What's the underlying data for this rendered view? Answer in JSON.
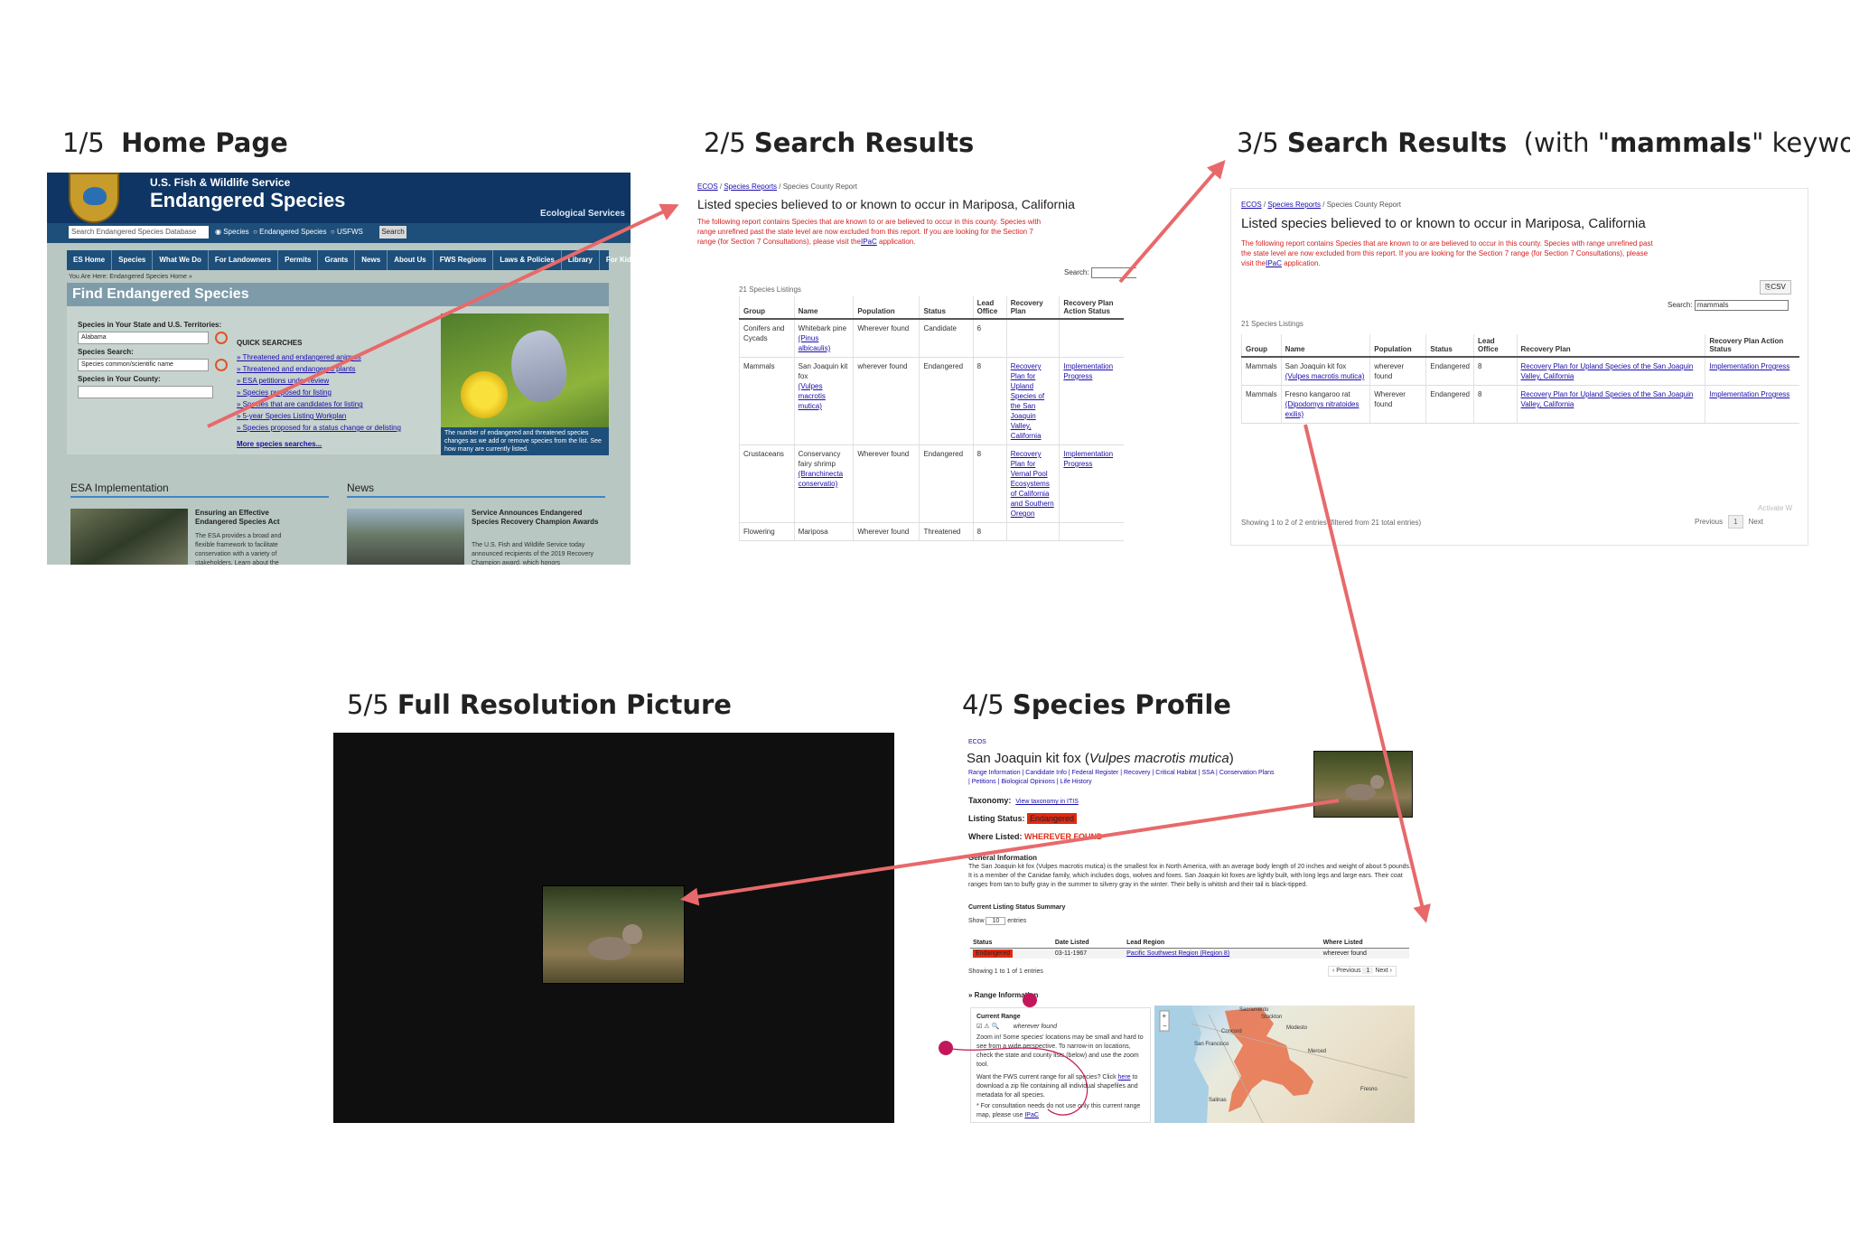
{
  "titles": {
    "t1": {
      "num": "1/5",
      "text": "Home Page"
    },
    "t2": {
      "num": "2/5",
      "text": "Search Results"
    },
    "t3": {
      "num": "3/5",
      "text": "Search Results",
      "suffix_pre": "(with \"",
      "keyword": "mammals",
      "suffix_post": "\" keyword)"
    },
    "t4": {
      "num": "4/5",
      "text": "Species Profile"
    },
    "t5": {
      "num": "5/5",
      "text": "Full Resolution Picture"
    }
  },
  "home": {
    "agency": "U.S. Fish & Wildlife Service",
    "site_title": "Endangered Species",
    "eco": "Ecological Services",
    "search_placeholder": "Search Endangered Species Database",
    "radio_species": "Species",
    "radio_endangered": "Endangered Species",
    "radio_usfws": "USFWS",
    "search_button": "Search",
    "nav": [
      "ES Home",
      "Species",
      "What We Do",
      "For Landowners",
      "Permits",
      "Grants",
      "News",
      "About Us",
      "FWS Regions",
      "Laws & Policies",
      "Library",
      "For Kids"
    ],
    "crumb": "You Are Here: Endangered Species Home »",
    "find_title": "Find Endangered Species",
    "state_label": "Species in Your State and U.S. Territories:",
    "state_value": "Alabama",
    "species_search_label": "Species Search:",
    "species_search_placeholder": "Species common/scientific name",
    "county_label": "Species in Your County:",
    "quick_searches": "QUICK SEARCHES",
    "quick_links": [
      "Threatened and endangered animals",
      "Threatened and endangered plants",
      "ESA petitions under review",
      "Species proposed for listing",
      "Species that are candidates for listing",
      "5-year Species Listing Workplan",
      "Species proposed for a status change or delisting"
    ],
    "more": "More species searches...",
    "caption": "The number of endangered and threatened species changes as we add or remove species from the list. See how many are currently listed.",
    "esa_heading": "ESA Implementation",
    "news_heading": "News",
    "article1_title": "Ensuring an Effective Endangered Species Act",
    "article1_text": "The ESA provides a broad and flexible framework to facilitate conservation with a variety of stakeholders. Learn about the",
    "article2_title": "Service Announces Endangered Species Recovery Champion Awards",
    "article2_text": "The U.S. Fish and Wildlife Service today announced recipients of the 2019 Recovery Champion award, which honors"
  },
  "report": {
    "crumb_ecos": "ECOS",
    "crumb_reports": "Species Reports",
    "crumb_current": "Species County Report",
    "title": "Listed species believed to or known to occur in Mariposa, California",
    "note_pre": "The following report contains Species that are known to or are believed to occur in this county. Species with range unrefined past the state level are now excluded from this report. If you are looking for the Section 7 range (for Section 7 Consultations), please visit the",
    "note_link": "IPaC",
    "note_post": " application.",
    "csv": "CSV",
    "search_label": "Search:",
    "search_value": "mammals",
    "count": "21 Species Listings",
    "headers": [
      "Group",
      "Name",
      "Population",
      "Status",
      "Lead Office",
      "Recovery Plan",
      "Recovery Plan Action Status"
    ],
    "rows_all": [
      {
        "group": "Conifers and Cycads",
        "name": "Whitebark pine",
        "sci": "Pinus albicaulis",
        "pop": "Wherever found",
        "status": "Candidate",
        "office": "6",
        "plan": "",
        "action": ""
      },
      {
        "group": "Mammals",
        "name": "San Joaquin kit fox",
        "sci": "Vulpes macrotis mutica",
        "pop": "wherever found",
        "status": "Endangered",
        "office": "8",
        "plan": "Recovery Plan for Upland Species of the San Joaquin Valley, California",
        "action": "Implementation Progress"
      },
      {
        "group": "Crustaceans",
        "name": "Conservancy fairy shrimp",
        "sci": "Branchinecta conservatio",
        "pop": "Wherever found",
        "status": "Endangered",
        "office": "8",
        "plan": "Recovery Plan for Vernal Pool Ecosystems of California and Southern Oregon",
        "action": "Implementation Progress"
      },
      {
        "group": "Flowering",
        "name": "Mariposa",
        "sci": "",
        "pop": "Wherever found",
        "status": "Threatened",
        "office": "8",
        "plan": "",
        "action": ""
      }
    ],
    "rows_mammals": [
      {
        "group": "Mammals",
        "name": "San Joaquin kit fox",
        "sci": "Vulpes macrotis mutica",
        "pop": "wherever found",
        "status": "Endangered",
        "office": "8",
        "plan": "Recovery Plan for Upland Species of the San Joaquin Valley, California",
        "action": "Implementation Progress"
      },
      {
        "group": "Mammals",
        "name": "Fresno kangaroo rat",
        "sci": "Dipodomys nitratoides exilis",
        "pop": "Wherever found",
        "status": "Endangered",
        "office": "8",
        "plan": "Recovery Plan for Upland Species of the San Joaquin Valley, California",
        "action": "Implementation Progress"
      }
    ],
    "showing": "Showing 1 to 2 of 2 entries (filtered from 21 total entries)",
    "previous": "Previous",
    "page": "1",
    "next": "Next",
    "watermark": "Activate W"
  },
  "profile": {
    "ecos": "ECOS",
    "common": "San Joaquin kit fox (",
    "scientific": "Vulpes macrotis mutica",
    "close": ")",
    "links_line1": "Range Information | Candidate Info | Federal Register | Recovery | Critical Habitat | SSA | Conservation Plans",
    "links_line2": "| Petitions | Biological Opinions | Life History",
    "taxonomy_label": "Taxonomy:",
    "taxonomy_link": "View taxonomy in ITIS",
    "listing_label": "Listing Status:",
    "listing_value": "Endangered",
    "where_label": "Where Listed:",
    "where_value": "WHEREVER FOUND",
    "general_heading": "General Information",
    "general_text": "The San Joaquin kit fox (Vulpes macrotis mutica) is the smallest fox in North America, with an average body length of 20 inches and weight of about 5 pounds. It is a member of the Canidae family, which includes dogs, wolves and foxes. San Joaquin kit foxes are lightly built, with long legs and large ears. Their coat ranges from tan to buffy gray in the summer to silvery gray in the winter. Their belly is whitish and their tail is black-tipped.",
    "summary_heading": "Current Listing Status Summary",
    "show": "Show",
    "show_value": "10",
    "entries": "entries",
    "table_headers": [
      "Status",
      "Date Listed",
      "Lead Region",
      "Where Listed"
    ],
    "table_row": {
      "status": "Endangered",
      "date": "03-11-1967",
      "region": "Pacific Southwest Region (Region 8)",
      "where": "wherever found"
    },
    "showing": "Showing 1 to 1 of 1 entries",
    "previous": "‹ Previous",
    "page": "1",
    "next": "Next ›",
    "range_heading": "» Range Information",
    "current_range": "Current Range",
    "wherever": "wherever found",
    "zoom_text": "Zoom in! Some species' locations may be small and hard to see from a wide perspective. To narrow-in on locations, check the state and county lists (below) and use the zoom tool.",
    "want_text": "Want the FWS current range for all species? Click",
    "here": "here",
    "want_text2": "to download a zip file containing all individual shapefiles and metadata for all species.",
    "consult_text": "* For consultation needs do not use only this current range map, please use",
    "ipac": "IPaC",
    "map_labels": [
      "San Francisco",
      "Stockton",
      "Modesto",
      "Merced",
      "Fresno",
      "Salinas",
      "Sacramento",
      "Concord"
    ]
  },
  "colors": {
    "arrow": "#e8696b",
    "marker": "#c2185b",
    "endangered": "#e02a12",
    "range": "#e8704a"
  }
}
